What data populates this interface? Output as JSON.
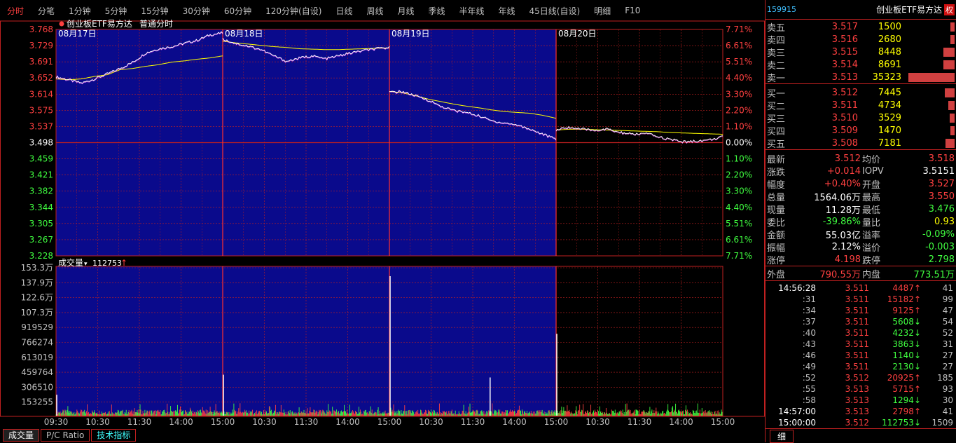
{
  "toolbar": {
    "tabs": [
      "分时",
      "分笔",
      "1分钟",
      "5分钟",
      "15分钟",
      "30分钟",
      "60分钟",
      "120分钟(自设)",
      "日线",
      "周线",
      "月线",
      "季线",
      "半年线",
      "年线",
      "45日线(自设)",
      "明细",
      "F10"
    ]
  },
  "chart_header": {
    "title": "创业板ETF易方达",
    "mode": "普通分时"
  },
  "volume_header": {
    "label": "成交量",
    "value": "112753"
  },
  "day_labels": [
    "08月17日",
    "08月18日",
    "08月19日",
    "08月20日"
  ],
  "bottom_tabs": [
    "成交量",
    "P/C Ratio",
    "技术指标"
  ],
  "colors": {
    "up": "#ff4040",
    "down": "#40ff40",
    "grid": "#c02020",
    "history_bg": "#0a0a8c",
    "price_line": "#ffffff",
    "avg_line": "#ffff00"
  },
  "chart_data": {
    "type": "line",
    "price_ticks": [
      "3.768",
      "3.729",
      "3.691",
      "3.652",
      "3.614",
      "3.575",
      "3.537",
      "3.498",
      "3.459",
      "3.421",
      "3.382",
      "3.344",
      "3.305",
      "3.267",
      "3.228"
    ],
    "pct_ticks": [
      "7.71%",
      "6.61%",
      "5.51%",
      "4.40%",
      "3.30%",
      "2.20%",
      "1.10%",
      "0.00%",
      "1.10%",
      "2.20%",
      "3.30%",
      "4.40%",
      "5.51%",
      "6.61%",
      "7.71%"
    ],
    "volume_ticks": [
      "153.3万",
      "137.9万",
      "122.6万",
      "107.3万",
      "919529",
      "766274",
      "613019",
      "459764",
      "306510",
      "153255"
    ],
    "time_ticks": [
      "09:30",
      "10:30",
      "11:30",
      "14:00",
      "15:00",
      "10:30",
      "11:30",
      "14:00",
      "15:00",
      "10:30",
      "11:30",
      "14:00",
      "15:00",
      "10:30",
      "11:30",
      "14:00",
      "15:00"
    ],
    "ylim": [
      3.228,
      3.768
    ],
    "vol_max": 1533000,
    "series": [
      {
        "price": [
          3.655,
          3.648,
          3.64,
          3.65,
          3.662,
          3.675,
          3.69,
          3.712,
          3.722,
          3.727,
          3.735,
          3.742,
          3.755,
          3.76
        ],
        "avg": [
          3.65,
          3.648,
          3.65,
          3.656,
          3.66,
          3.672,
          3.675,
          3.68,
          3.684,
          3.69,
          3.693,
          3.697,
          3.7,
          3.705
        ]
      },
      {
        "price": [
          3.745,
          3.735,
          3.728,
          3.72,
          3.705,
          3.692,
          3.7,
          3.705,
          3.698,
          3.705,
          3.712,
          3.718,
          3.722,
          3.725
        ],
        "avg": [
          3.74,
          3.736,
          3.733,
          3.73,
          3.727,
          3.725,
          3.722,
          3.721,
          3.72,
          3.72,
          3.721,
          3.722,
          3.723,
          3.724
        ]
      },
      {
        "price": [
          3.618,
          3.62,
          3.61,
          3.6,
          3.585,
          3.575,
          3.57,
          3.562,
          3.55,
          3.545,
          3.54,
          3.53,
          3.518,
          3.506
        ],
        "avg": [
          3.62,
          3.617,
          3.61,
          3.602,
          3.596,
          3.59,
          3.585,
          3.581,
          3.576,
          3.572,
          3.57,
          3.568,
          3.563,
          3.556
        ]
      },
      {
        "price": [
          3.528,
          3.535,
          3.53,
          3.528,
          3.53,
          3.522,
          3.518,
          3.52,
          3.512,
          3.505,
          3.5,
          3.502,
          3.505,
          3.512
        ],
        "avg": [
          3.528,
          3.53,
          3.53,
          3.529,
          3.528,
          3.527,
          3.526,
          3.525,
          3.524,
          3.522,
          3.521,
          3.52,
          3.519,
          3.518
        ]
      }
    ],
    "volume_spikes": [
      {
        "day": 0,
        "pos": 0.0,
        "value": 230000
      },
      {
        "day": 1,
        "pos": 0.0,
        "value": 450000
      },
      {
        "day": 2,
        "pos": 0.0,
        "value": 1533000
      },
      {
        "day": 2,
        "pos": 0.6,
        "value": 420000
      },
      {
        "day": 3,
        "pos": 0.0,
        "value": 900000
      }
    ]
  },
  "quote": {
    "code": "159915",
    "name": "创业板ETF易方达",
    "rights": "权",
    "asks": [
      {
        "label": "卖五",
        "price": "3.517",
        "vol": "1500",
        "bar": 0.04
      },
      {
        "label": "卖四",
        "price": "3.516",
        "vol": "2680",
        "bar": 0.07
      },
      {
        "label": "卖三",
        "price": "3.515",
        "vol": "8448",
        "bar": 0.24
      },
      {
        "label": "卖二",
        "price": "3.514",
        "vol": "8691",
        "bar": 0.25
      },
      {
        "label": "卖一",
        "price": "3.513",
        "vol": "35323",
        "bar": 1.0
      }
    ],
    "bids": [
      {
        "label": "买一",
        "price": "3.512",
        "vol": "7445",
        "bar": 0.21
      },
      {
        "label": "买二",
        "price": "3.511",
        "vol": "4734",
        "bar": 0.13
      },
      {
        "label": "买三",
        "price": "3.510",
        "vol": "3529",
        "bar": 0.1
      },
      {
        "label": "买四",
        "price": "3.509",
        "vol": "1470",
        "bar": 0.04
      },
      {
        "label": "买五",
        "price": "3.508",
        "vol": "7181",
        "bar": 0.2
      }
    ],
    "info": [
      {
        "l": "最新",
        "v": "3.512",
        "vc": "red",
        "l2": "均价",
        "v2": "3.518",
        "v2c": "red"
      },
      {
        "l": "涨跌",
        "v": "+0.014",
        "vc": "red",
        "l2": "IOPV",
        "v2": "3.5151",
        "v2c": "white"
      },
      {
        "l": "幅度",
        "v": "+0.40%",
        "vc": "red",
        "l2": "开盘",
        "v2": "3.527",
        "v2c": "red"
      },
      {
        "l": "总量",
        "v": "1564.06万",
        "vc": "white",
        "l2": "最高",
        "v2": "3.550",
        "v2c": "red"
      },
      {
        "l": "现量",
        "v": "11.28万",
        "vc": "white",
        "l2": "最低",
        "v2": "3.476",
        "v2c": "green"
      },
      {
        "l": "委比",
        "v": "-39.86%",
        "vc": "green",
        "l2": "量比",
        "v2": "0.93",
        "v2c": "yellow"
      },
      {
        "l": "金额",
        "v": "55.03亿",
        "vc": "white",
        "l2": "溢率",
        "v2": "-0.09%",
        "v2c": "green"
      },
      {
        "l": "振幅",
        "v": "2.12%",
        "vc": "white",
        "l2": "溢价",
        "v2": "-0.003",
        "v2c": "green"
      },
      {
        "l": "涨停",
        "v": "4.198",
        "vc": "red",
        "l2": "跌停",
        "v2": "2.798",
        "v2c": "green"
      }
    ],
    "outer": {
      "l": "外盘",
      "v": "790.55万",
      "l2": "内盘",
      "v2": "773.51万"
    },
    "ticks": [
      {
        "t": "14:56:28",
        "p": "3.511",
        "v": "4487",
        "d": "up",
        "n": "41"
      },
      {
        "t": ":31",
        "p": "3.511",
        "v": "15182",
        "d": "up",
        "n": "99"
      },
      {
        "t": ":34",
        "p": "3.511",
        "v": "9125",
        "d": "up",
        "n": "47"
      },
      {
        "t": ":37",
        "p": "3.511",
        "v": "5608",
        "d": "down",
        "n": "54"
      },
      {
        "t": ":40",
        "p": "3.511",
        "v": "4232",
        "d": "down",
        "n": "52"
      },
      {
        "t": ":43",
        "p": "3.511",
        "v": "3863",
        "d": "down",
        "n": "31"
      },
      {
        "t": ":46",
        "p": "3.511",
        "v": "1140",
        "d": "down",
        "n": "27"
      },
      {
        "t": ":49",
        "p": "3.511",
        "v": "2130",
        "d": "down",
        "n": "27"
      },
      {
        "t": ":52",
        "p": "3.512",
        "v": "20925",
        "d": "up",
        "n": "185"
      },
      {
        "t": ":55",
        "p": "3.513",
        "v": "5715",
        "d": "up",
        "n": "93"
      },
      {
        "t": ":58",
        "p": "3.513",
        "v": "1294",
        "d": "down",
        "n": "30"
      },
      {
        "t": "14:57:00",
        "p": "3.513",
        "v": "2798",
        "d": "up",
        "n": "41"
      },
      {
        "t": "15:00:00",
        "p": "3.512",
        "v": "112753",
        "d": "down",
        "n": "1509"
      }
    ],
    "detail_tab": "细"
  }
}
